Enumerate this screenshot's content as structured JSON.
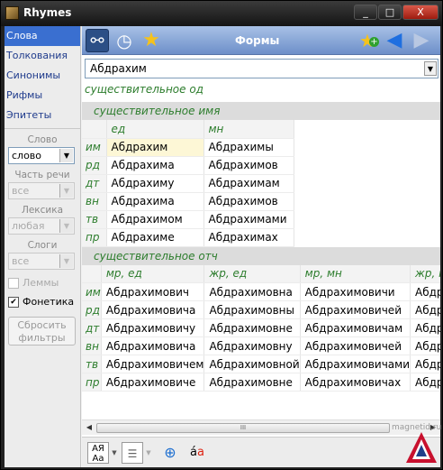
{
  "window": {
    "title": "Rhymes",
    "min": "_",
    "max": "□",
    "close": "X"
  },
  "sidebar": {
    "items": [
      {
        "label": "Слова",
        "active": true
      },
      {
        "label": "Толкования",
        "active": false
      },
      {
        "label": "Синонимы",
        "active": false
      },
      {
        "label": "Рифмы",
        "active": false
      },
      {
        "label": "Эпитеты",
        "active": false
      }
    ],
    "filters": {
      "word_label": "Слово",
      "word_value": "слово",
      "pos_label": "Часть речи",
      "pos_value": "все",
      "lex_label": "Лексика",
      "lex_value": "любая",
      "syl_label": "Слоги",
      "syl_value": "все",
      "lemmas_label": "Леммы",
      "lemmas_checked": false,
      "phonetics_label": "Фонетика",
      "phonetics_checked": true,
      "reset_label": "Сбросить фильтры"
    }
  },
  "toolbar": {
    "title": "Формы",
    "icons": [
      "binoculars-icon",
      "clock-icon",
      "star-icon",
      "star-add-icon",
      "back-arrow-icon",
      "forward-arrow-icon"
    ]
  },
  "word_combo": {
    "value": "Абдрахим"
  },
  "part_of_speech": "существительное од",
  "sections": [
    {
      "title": "существительное имя",
      "columns": [
        "ед",
        "мн"
      ],
      "rows": [
        {
          "case": "им",
          "cells": [
            "Абдрахим",
            "Абдрахимы"
          ]
        },
        {
          "case": "рд",
          "cells": [
            "Абдрахима",
            "Абдрахимов"
          ]
        },
        {
          "case": "дт",
          "cells": [
            "Абдрахиму",
            "Абдрахимам"
          ]
        },
        {
          "case": "вн",
          "cells": [
            "Абдрахима",
            "Абдрахимов"
          ]
        },
        {
          "case": "тв",
          "cells": [
            "Абдрахимом",
            "Абдрахимами"
          ]
        },
        {
          "case": "пр",
          "cells": [
            "Абдрахиме",
            "Абдрахимах"
          ]
        }
      ]
    },
    {
      "title": "существительное отч",
      "columns": [
        "мр, ед",
        "жр, ед",
        "мр, мн",
        "жр, мн"
      ],
      "rows": [
        {
          "case": "им",
          "cells": [
            "Абдрахимович",
            "Абдрахимовна",
            "Абдрахимовичи",
            "Абдрах"
          ]
        },
        {
          "case": "рд",
          "cells": [
            "Абдрахимовича",
            "Абдрахимовны",
            "Абдрахимовичей",
            "Абдрах"
          ]
        },
        {
          "case": "дт",
          "cells": [
            "Абдрахимовичу",
            "Абдрахимовне",
            "Абдрахимовичам",
            "Абдрах"
          ]
        },
        {
          "case": "вн",
          "cells": [
            "Абдрахимовича",
            "Абдрахимовну",
            "Абдрахимовичей",
            "Абдрах"
          ]
        },
        {
          "case": "тв",
          "cells": [
            "Абдрахимовичем",
            "Абдрахимовной",
            "Абдрахимовичами",
            "Абдрах"
          ]
        },
        {
          "case": "пр",
          "cells": [
            "Абдрахимовиче",
            "Абдрахимовне",
            "Абдрахимовичах",
            "Абдрах"
          ]
        }
      ]
    }
  ],
  "scrollbar": {
    "grip": "III"
  },
  "bottom_icons": [
    "font-case-icon",
    "layout-icon",
    "zoom-icon",
    "spellcheck-icon"
  ],
  "watermark": "magnetid.ru",
  "colors": {
    "accent": "#3a6fd0",
    "green_label": "#2d7d2d",
    "toolbar": "#8aa8d8"
  }
}
